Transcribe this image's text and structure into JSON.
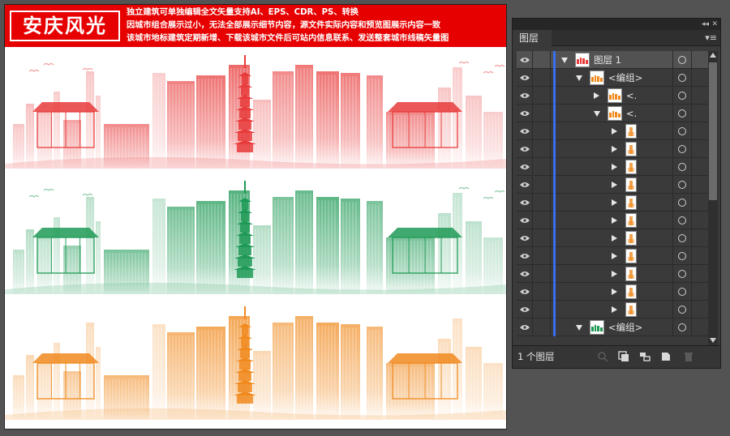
{
  "artboard": {
    "title": "安庆风光",
    "blurb_lines": [
      "独立建筑可单独编辑全文矢量支持AI、EPS、CDR、PS、转换",
      "因城市组合展示过小，无法全部展示细节内容，源文件实际内容和预览图展示内容一致",
      "该城市地标建筑定期新增、下载该城市文件后可站内信息联系、发送整套城市线稿矢量图"
    ],
    "skyline_colors": [
      "#e83b3b",
      "#1f9a56",
      "#f08a1e"
    ],
    "banner_color": "#e60000"
  },
  "panel": {
    "tab_label": "图层",
    "collapse_icon": "double-chevron-left-icon",
    "close_icon": "close-icon",
    "menu_icon": "panel-menu-icon",
    "footer_count": "1 个图层",
    "footer_icons": [
      "locate-object-icon",
      "make-clipping-mask-icon",
      "create-sublayer-icon",
      "create-new-layer-icon",
      "delete-layer-icon"
    ],
    "rows": [
      {
        "label": "图层 1",
        "kind": "layer",
        "expanded": true,
        "thumb": "color-skyline-thumb"
      },
      {
        "label": "<编组>",
        "kind": "group",
        "expanded": true,
        "thumb": "orange-skyline-thumb"
      },
      {
        "label": "<.",
        "kind": "group",
        "expanded": false,
        "thumb": "orange-strip-thumb"
      },
      {
        "label": "<.",
        "kind": "group",
        "expanded": true,
        "thumb": "orange-strip-thumb"
      },
      {
        "label": "",
        "kind": "item",
        "expanded": false,
        "thumb": "orange-building-thumb"
      },
      {
        "label": "",
        "kind": "item",
        "expanded": false,
        "thumb": "orange-building-thumb"
      },
      {
        "label": "",
        "kind": "item",
        "expanded": false,
        "thumb": "orange-building-thumb"
      },
      {
        "label": "",
        "kind": "item",
        "expanded": false,
        "thumb": "orange-building-thumb"
      },
      {
        "label": "",
        "kind": "item",
        "expanded": false,
        "thumb": "orange-building-thumb"
      },
      {
        "label": "",
        "kind": "item",
        "expanded": false,
        "thumb": "orange-building-thumb"
      },
      {
        "label": "",
        "kind": "item",
        "expanded": false,
        "thumb": "orange-building-thumb"
      },
      {
        "label": "",
        "kind": "item",
        "expanded": false,
        "thumb": "orange-building-thumb"
      },
      {
        "label": "",
        "kind": "item",
        "expanded": false,
        "thumb": "orange-building-thumb"
      },
      {
        "label": "",
        "kind": "item",
        "expanded": false,
        "thumb": "orange-building-thumb"
      },
      {
        "label": "",
        "kind": "item",
        "expanded": false,
        "thumb": "orange-building-thumb"
      },
      {
        "label": "<编组>",
        "kind": "group",
        "expanded": true,
        "thumb": "green-skyline-thumb"
      }
    ]
  }
}
